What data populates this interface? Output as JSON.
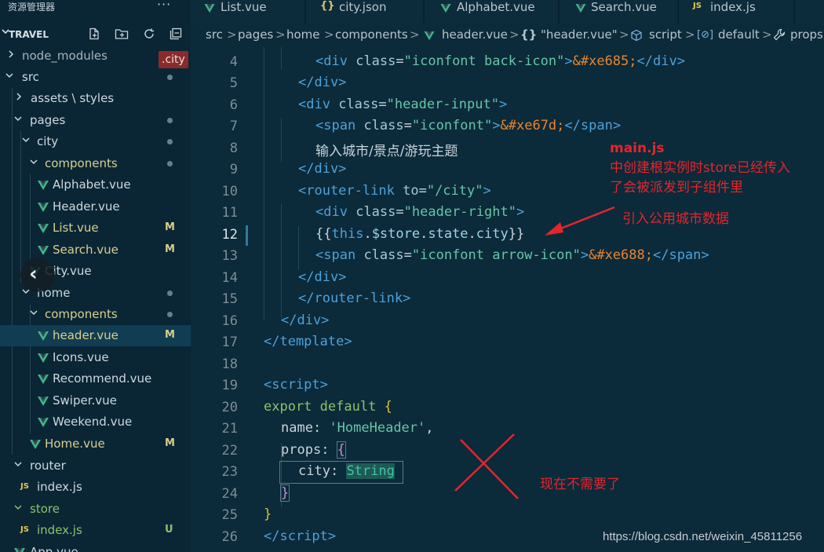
{
  "explorer": {
    "title": "资源管理器",
    "more_label": "···",
    "project": "TRAVEL",
    "actions": [
      "new-file-icon",
      "new-folder-icon",
      "refresh-icon",
      "collapse-all-icon"
    ]
  },
  "tooltip": ".city",
  "tree": [
    {
      "label": "node_modules",
      "badge": ""
    },
    {
      "label": "src",
      "badge": ""
    },
    {
      "label": "assets \\ styles",
      "badge": ""
    },
    {
      "label": "pages",
      "badge": ""
    },
    {
      "label": "city",
      "badge": ""
    },
    {
      "label": "components",
      "badge": ""
    },
    {
      "label": "Alphabet.vue",
      "badge": ""
    },
    {
      "label": "Header.vue",
      "badge": ""
    },
    {
      "label": "List.vue",
      "badge": "M"
    },
    {
      "label": "Search.vue",
      "badge": "M"
    },
    {
      "label": "City.vue",
      "badge": ""
    },
    {
      "label": "home",
      "badge": ""
    },
    {
      "label": "components",
      "badge": ""
    },
    {
      "label": "header.vue",
      "badge": "M"
    },
    {
      "label": "Icons.vue",
      "badge": ""
    },
    {
      "label": "Recommend.vue",
      "badge": ""
    },
    {
      "label": "Swiper.vue",
      "badge": ""
    },
    {
      "label": "Weekend.vue",
      "badge": ""
    },
    {
      "label": "Home.vue",
      "badge": "M"
    },
    {
      "label": "router",
      "badge": ""
    },
    {
      "label": "index.js",
      "badge": ""
    },
    {
      "label": "store",
      "badge": ""
    },
    {
      "label": "index.js",
      "badge": "U"
    },
    {
      "label": "App.vue",
      "badge": ""
    }
  ],
  "tabs": [
    {
      "label": "List.vue",
      "icon": "vue-icon"
    },
    {
      "label": "city.json",
      "icon": "json-icon"
    },
    {
      "label": "Alphabet.vue",
      "icon": "vue-icon"
    },
    {
      "label": "Search.vue",
      "icon": "vue-icon"
    },
    {
      "label": "index.js",
      "icon": "js-icon"
    }
  ],
  "breadcrumb": {
    "src": "src",
    "pages": "pages",
    "home": "home",
    "components": "components",
    "file": "header.vue",
    "braces": "{}",
    "quoted": "\"header.vue\"",
    "script": "script",
    "default": "default",
    "props": "props"
  },
  "editor": {
    "line_numbers": [
      "4",
      "5",
      "6",
      "7",
      "8",
      "9",
      "10",
      "11",
      "12",
      "13",
      "14",
      "15",
      "16",
      "17",
      "18",
      "19",
      "20",
      "21",
      "22",
      "23",
      "24",
      "25",
      "26"
    ],
    "code_text": {
      "l4_class": "iconfont back-icon",
      "l4_entity": "&#xe685;",
      "l6_class": "header-input",
      "l7_class": "iconfont",
      "l7_entity": "&#xe67d;",
      "l8_text": "输入城市/景点/游玩主题",
      "l10_to": "/city",
      "l11_class": "header-right",
      "l12_expr_this": "this",
      "l12_expr_store": "$store",
      "l12_expr_state": "state",
      "l12_expr_city": "city",
      "l13_class": "iconfont arrow-icon",
      "l13_entity": "&#xe688;",
      "l21_value": "'HomeHeader'",
      "l23_type": "String"
    }
  },
  "annotations": {
    "main_title": "main.js",
    "main_line1": "中创建根实例时store已经传入",
    "main_line2": "了会被派发到子组件里",
    "arrow_note": "引入公用城市数据",
    "cross_note": "现在不需要了"
  },
  "watermark": "https://blog.csdn.net/weixin_45811256",
  "colors": {
    "annotation_red": "#e3262b",
    "tag_blue": "#4ea1d9",
    "string_green": "#66c6a4",
    "entity_orange": "#e8852f",
    "vue_green": "#41b883"
  }
}
